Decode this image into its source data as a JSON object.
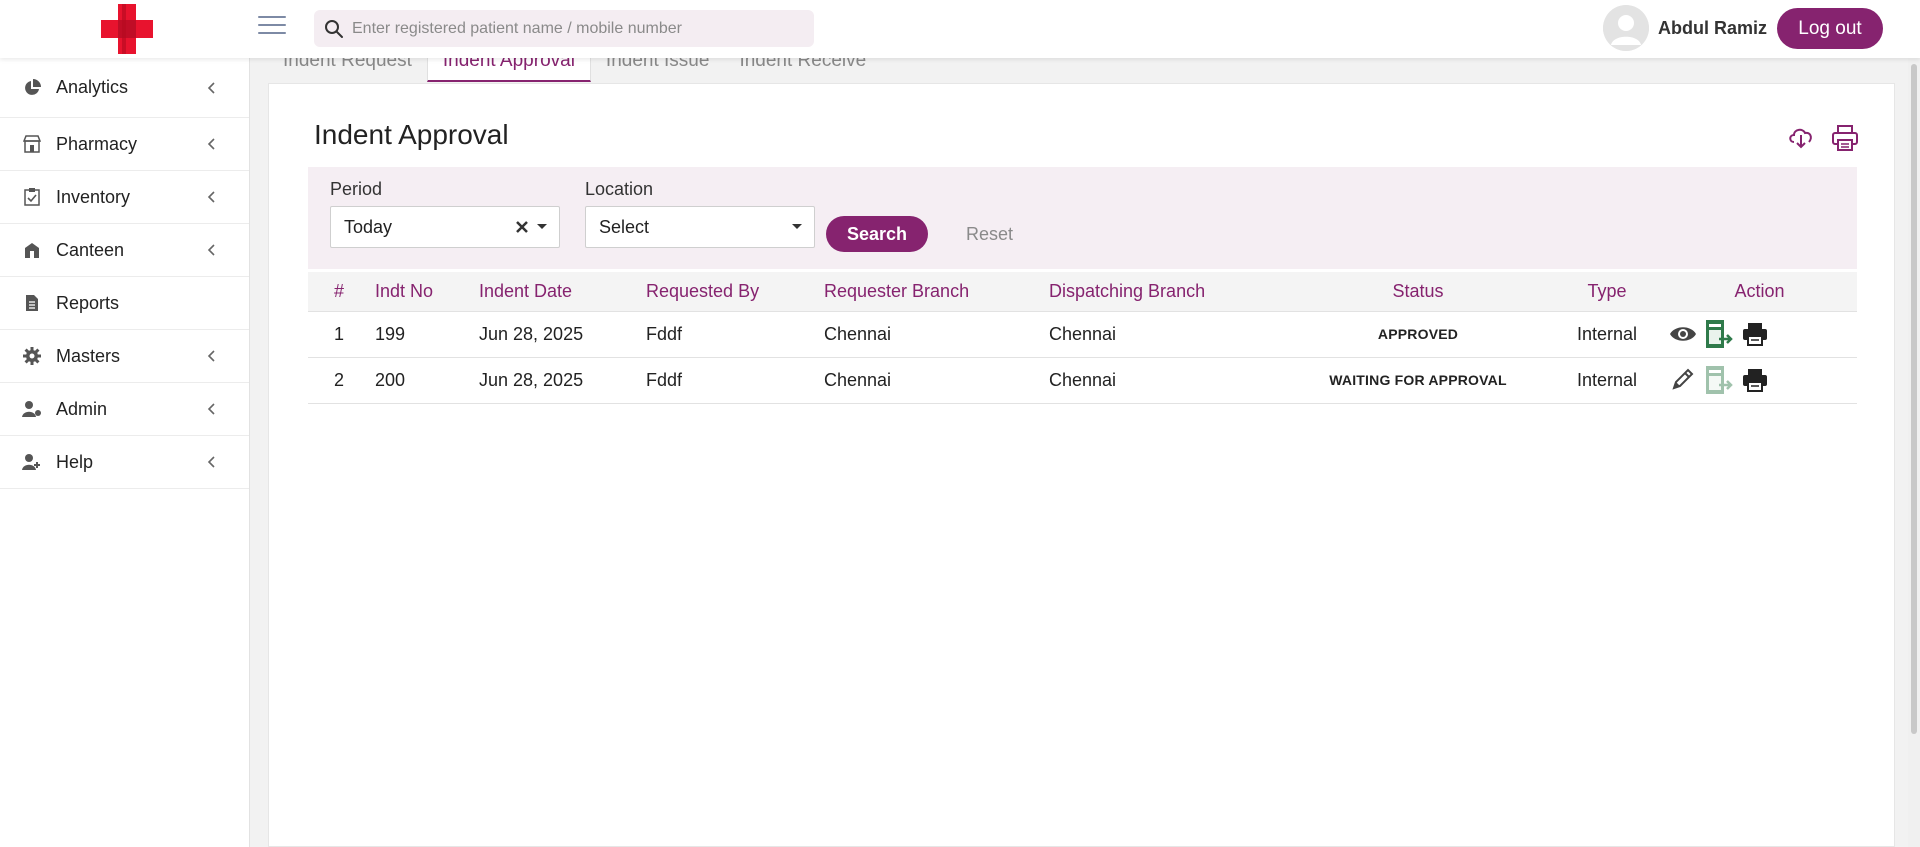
{
  "header": {
    "search_placeholder": "Enter registered patient name / mobile number",
    "user_name": "Abdul Ramiz",
    "logout_label": "Log out"
  },
  "sidebar": {
    "items": [
      {
        "label": "Analytics",
        "icon": "pie-chart-icon",
        "has_chevron": true
      },
      {
        "label": "Pharmacy",
        "icon": "store-icon",
        "has_chevron": true
      },
      {
        "label": "Inventory",
        "icon": "clipboard-check-icon",
        "has_chevron": true
      },
      {
        "label": "Canteen",
        "icon": "canteen-icon",
        "has_chevron": true
      },
      {
        "label": "Reports",
        "icon": "document-icon",
        "has_chevron": false
      },
      {
        "label": "Masters",
        "icon": "gear-icon",
        "has_chevron": true
      },
      {
        "label": "Admin",
        "icon": "user-gear-icon",
        "has_chevron": true
      },
      {
        "label": "Help",
        "icon": "user-help-icon",
        "has_chevron": true
      }
    ]
  },
  "tabs": [
    "Indent Request",
    "Indent Approval",
    "Indent Issue",
    "Indent Receive"
  ],
  "active_tab": "Indent Approval",
  "page": {
    "title": "Indent Approval"
  },
  "filters": {
    "period_label": "Period",
    "period_value": "Today",
    "location_label": "Location",
    "location_value": "Select",
    "search_label": "Search",
    "reset_label": "Reset"
  },
  "table": {
    "columns": [
      "#",
      "Indt No",
      "Indent Date",
      "Requested By",
      "Requester Branch",
      "Dispatching Branch",
      "Status",
      "Type",
      "Action"
    ],
    "rows": [
      {
        "num": "1",
        "indt_no": "199",
        "date": "Jun 28, 2025",
        "requested_by": "Fddf",
        "requester_branch": "Chennai",
        "dispatching_branch": "Chennai",
        "status": "APPROVED",
        "type": "Internal",
        "first_action": "view-icon"
      },
      {
        "num": "2",
        "indt_no": "200",
        "date": "Jun 28, 2025",
        "requested_by": "Fddf",
        "requester_branch": "Chennai",
        "dispatching_branch": "Chennai",
        "status": "WAITING FOR APPROVAL",
        "type": "Internal",
        "first_action": "edit-icon"
      }
    ]
  },
  "colors": {
    "brand": "#86236f",
    "approved": "#1e8a1e",
    "waiting": "#f5a623"
  }
}
